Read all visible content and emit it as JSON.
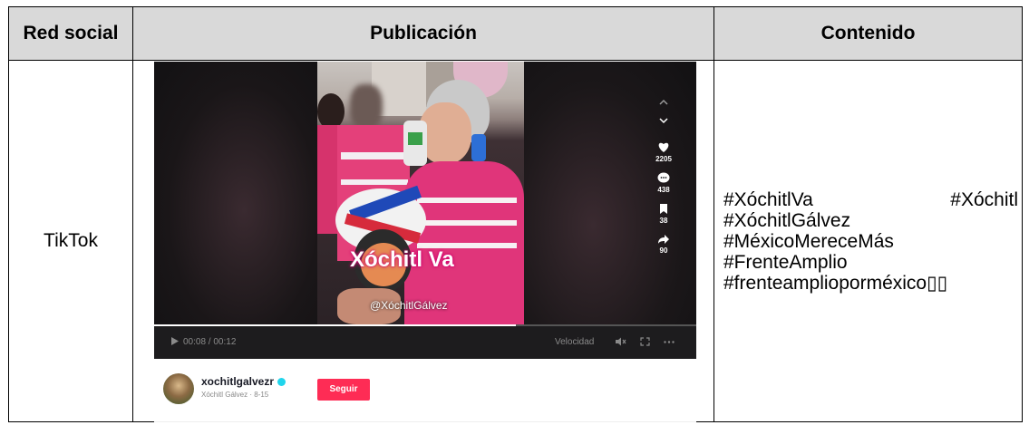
{
  "table": {
    "headers": {
      "network": "Red social",
      "post": "Publicación",
      "content": "Contenido"
    },
    "row": {
      "network": "TikTok",
      "content_tags": [
        "#XóchitlVa",
        "#Xóchitl",
        "#XóchitlGálvez",
        "#MéxicoMereceMás",
        "#FrenteAmplio",
        "#frenteamplioporméxico▯▯"
      ]
    }
  },
  "tiktok": {
    "overlay_title": "Xóchitl Va",
    "overlay_handle": "@XóchitlGálvez",
    "time": "00:08 / 00:12",
    "speed_label": "Velocidad",
    "likes": "2205",
    "comments": "438",
    "saves": "38",
    "shares": "90",
    "username": "xochitlgalvezr",
    "user_subtitle": "Xóchitl Gálvez · 8-15",
    "follow_label": "Seguir",
    "progress_fraction": 0.667,
    "colors": {
      "follow": "#fe2c55",
      "verified": "#20d5ec",
      "player_bg": "#161618"
    }
  }
}
